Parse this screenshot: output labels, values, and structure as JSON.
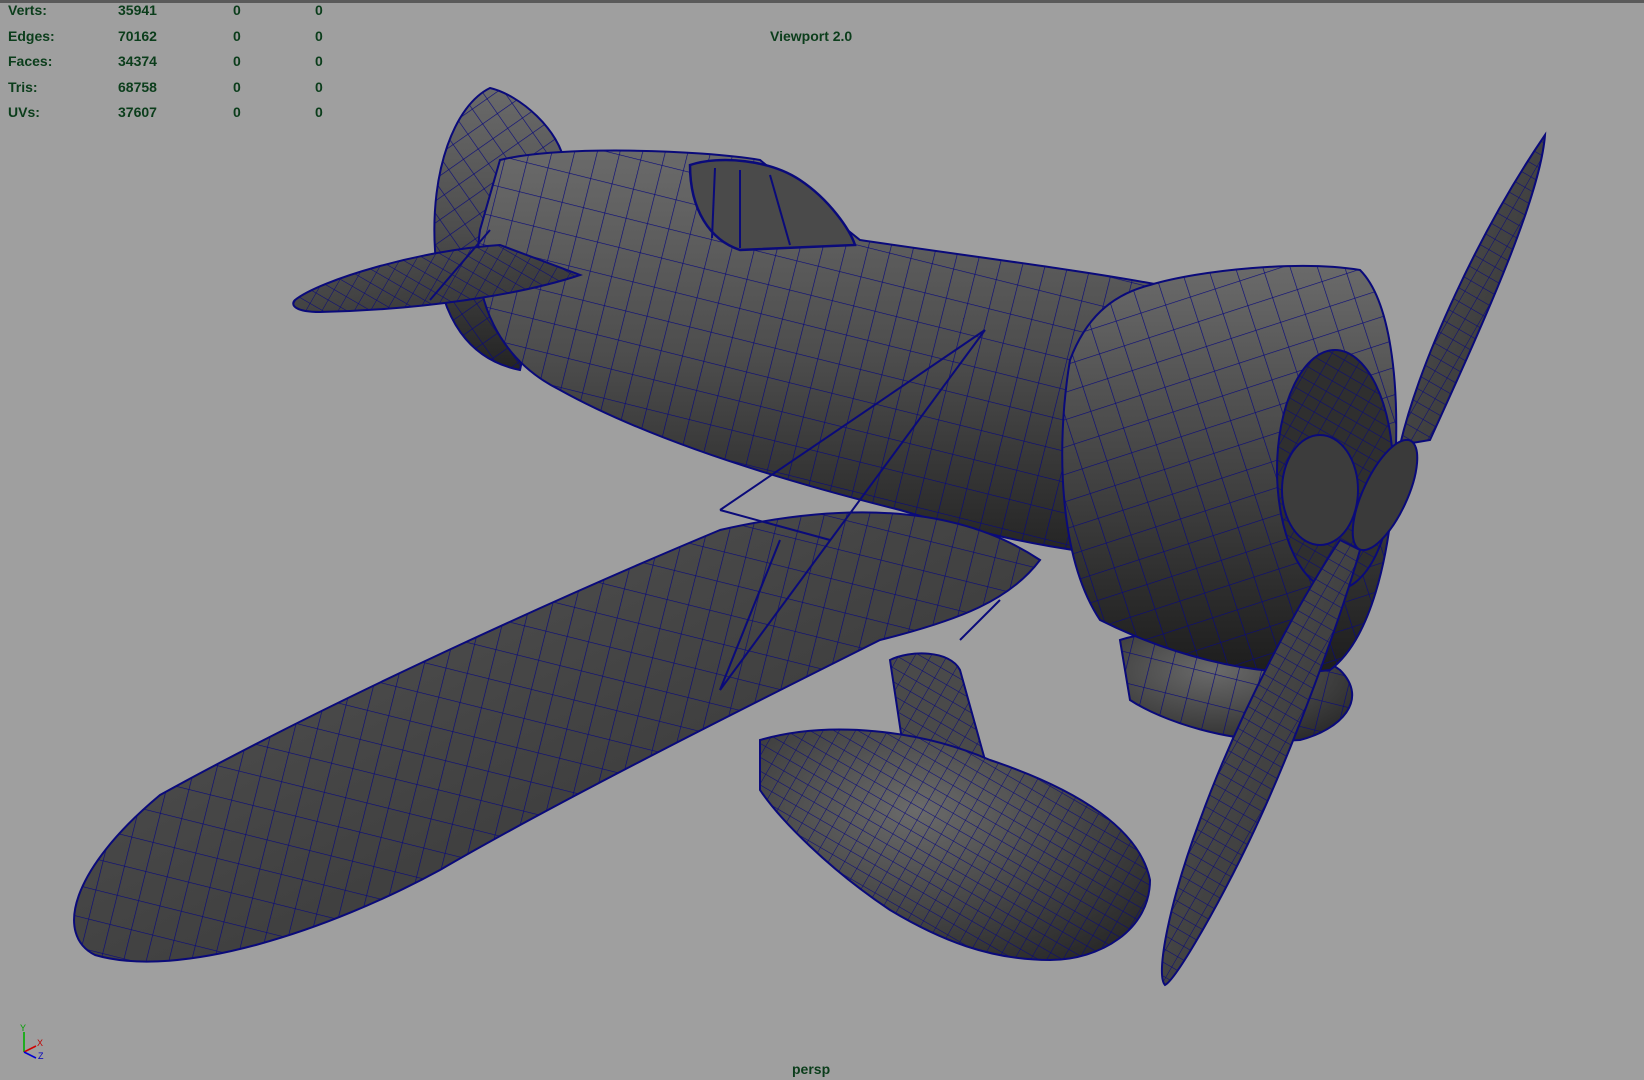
{
  "hud": {
    "rows": [
      {
        "label": "Verts:",
        "v1": "35941",
        "v2": "0",
        "v3": "0"
      },
      {
        "label": "Edges:",
        "v1": "70162",
        "v2": "0",
        "v3": "0"
      },
      {
        "label": "Faces:",
        "v1": "34374",
        "v2": "0",
        "v3": "0"
      },
      {
        "label": "Tris:",
        "v1": "68758",
        "v2": "0",
        "v3": "0"
      },
      {
        "label": "UVs:",
        "v1": "37607",
        "v2": "0",
        "v3": "0"
      }
    ]
  },
  "viewport": {
    "renderer": "Viewport 2.0",
    "camera": "persp",
    "background_color": "#9f9f9f",
    "wireframe_color": "#0a0a7a",
    "hud_text_color": "#0b3d1b"
  },
  "axis_gizmo": {
    "y_label": "Y",
    "x_label": "X",
    "z_label": "Z"
  }
}
